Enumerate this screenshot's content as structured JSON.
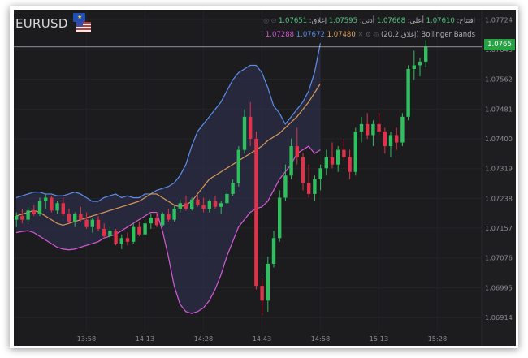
{
  "symbol": "EURUSD",
  "info": {
    "open_label": "افتتاح:",
    "open": "1.07610",
    "high_label": "أعلى:",
    "high": "1.07668",
    "low_label": "أدنى:",
    "low": "1.07595",
    "close_label": "إغلاق:",
    "close": "1.07651",
    "indicator_name": "Bollinger Bands",
    "indicator_params": "(إغلاق,20,2)",
    "upper": "1.07288",
    "middle": "1.07672",
    "lower": "1.07480"
  },
  "last_price": "1.0765",
  "colors": {
    "bull": "#2fbf5f",
    "bear": "#e0324a",
    "upper_band": "#5b8fe8",
    "lower_band": "#d65ad8",
    "middle_band": "#d99a58",
    "band_fill": "#2c2c48",
    "price_tag": "#27a345",
    "background": "#1c1c1f"
  },
  "chart_data": {
    "type": "candlestick",
    "y_ticks": [
      "1.07724",
      "1.07643",
      "1.07562",
      "1.07481",
      "1.07400",
      "1.07319",
      "1.07238",
      "1.07157",
      "1.07076",
      "1.06995",
      "1.06914"
    ],
    "x_ticks": [
      "13:58",
      "14:13",
      "14:28",
      "14:43",
      "14:58",
      "15:13",
      "15:28"
    ],
    "ylim": [
      1.0688,
      1.0775
    ],
    "candles": [
      [
        1.0718,
        1.072,
        1.0716,
        1.0719
      ],
      [
        1.0719,
        1.0721,
        1.0717,
        1.0718
      ],
      [
        1.0718,
        1.07215,
        1.07175,
        1.07205
      ],
      [
        1.07205,
        1.0722,
        1.0719,
        1.07195
      ],
      [
        1.07195,
        1.0724,
        1.0719,
        1.0723
      ],
      [
        1.0723,
        1.0725,
        1.0721,
        1.0724
      ],
      [
        1.0724,
        1.07245,
        1.072,
        1.07205
      ],
      [
        1.07205,
        1.0723,
        1.07195,
        1.07225
      ],
      [
        1.07225,
        1.0724,
        1.0719,
        1.07195
      ],
      [
        1.07195,
        1.0721,
        1.0717,
        1.07175
      ],
      [
        1.07175,
        1.072,
        1.0716,
        1.07195
      ],
      [
        1.07195,
        1.07215,
        1.07175,
        1.0718
      ],
      [
        1.0718,
        1.072,
        1.07155,
        1.0716
      ],
      [
        1.0716,
        1.07185,
        1.07145,
        1.0718
      ],
      [
        1.0718,
        1.0719,
        1.0715,
        1.07155
      ],
      [
        1.07155,
        1.0717,
        1.0713,
        1.07135
      ],
      [
        1.07135,
        1.0716,
        1.07125,
        1.0715
      ],
      [
        1.0715,
        1.07155,
        1.0711,
        1.07115
      ],
      [
        1.07115,
        1.0714,
        1.071,
        1.0713
      ],
      [
        1.0713,
        1.07145,
        1.0711,
        1.0712
      ],
      [
        1.0712,
        1.0717,
        1.07115,
        1.0716
      ],
      [
        1.0716,
        1.07175,
        1.07135,
        1.0714
      ],
      [
        1.0714,
        1.0718,
        1.07135,
        1.0717
      ],
      [
        1.0717,
        1.07195,
        1.07155,
        1.07185
      ],
      [
        1.07185,
        1.072,
        1.0716,
        1.07165
      ],
      [
        1.07165,
        1.072,
        1.0716,
        1.07195
      ],
      [
        1.07195,
        1.0721,
        1.07175,
        1.0718
      ],
      [
        1.0718,
        1.0722,
        1.07175,
        1.0721
      ],
      [
        1.0721,
        1.07235,
        1.072,
        1.07225
      ],
      [
        1.07225,
        1.07245,
        1.07205,
        1.0721
      ],
      [
        1.0721,
        1.0724,
        1.07205,
        1.07235
      ],
      [
        1.07235,
        1.0725,
        1.07215,
        1.0722
      ],
      [
        1.0722,
        1.0724,
        1.072,
        1.0721
      ],
      [
        1.0721,
        1.07235,
        1.072,
        1.0723
      ],
      [
        1.0723,
        1.07245,
        1.0721,
        1.07215
      ],
      [
        1.07215,
        1.0723,
        1.07195,
        1.07225
      ],
      [
        1.07225,
        1.07255,
        1.0722,
        1.0725
      ],
      [
        1.0725,
        1.0729,
        1.07245,
        1.0728
      ],
      [
        1.0728,
        1.0738,
        1.0727,
        1.0737
      ],
      [
        1.0737,
        1.0748,
        1.0736,
        1.0746
      ],
      [
        1.0746,
        1.075,
        1.0738,
        1.074
      ],
      [
        1.074,
        1.0742,
        1.0699,
        1.07
      ],
      [
        1.07,
        1.0702,
        1.0692,
        1.0696
      ],
      [
        1.0696,
        1.0708,
        1.0693,
        1.0706
      ],
      [
        1.0706,
        1.0715,
        1.0705,
        1.0713
      ],
      [
        1.0713,
        1.0726,
        1.0712,
        1.0724
      ],
      [
        1.0724,
        1.0733,
        1.0723,
        1.073
      ],
      [
        1.073,
        1.074,
        1.0729,
        1.0738
      ],
      [
        1.0738,
        1.0743,
        1.0733,
        1.0735
      ],
      [
        1.0735,
        1.0736,
        1.0726,
        1.0728
      ],
      [
        1.0728,
        1.0733,
        1.0724,
        1.0725
      ],
      [
        1.0725,
        1.073,
        1.0723,
        1.0729
      ],
      [
        1.0729,
        1.0733,
        1.0726,
        1.0732
      ],
      [
        1.0732,
        1.0737,
        1.073,
        1.0735
      ],
      [
        1.0735,
        1.0739,
        1.0732,
        1.0733
      ],
      [
        1.0733,
        1.0738,
        1.0731,
        1.0737
      ],
      [
        1.0737,
        1.074,
        1.0734,
        1.0735
      ],
      [
        1.0735,
        1.0737,
        1.0729,
        1.0731
      ],
      [
        1.0731,
        1.0743,
        1.073,
        1.0742
      ],
      [
        1.0742,
        1.0746,
        1.0739,
        1.0744
      ],
      [
        1.0744,
        1.0747,
        1.074,
        1.0741
      ],
      [
        1.0741,
        1.0745,
        1.0738,
        1.0744
      ],
      [
        1.0744,
        1.0747,
        1.0741,
        1.0742
      ],
      [
        1.0742,
        1.0743,
        1.0736,
        1.0738
      ],
      [
        1.0738,
        1.0742,
        1.0735,
        1.0741
      ],
      [
        1.0741,
        1.0743,
        1.0737,
        1.0739
      ],
      [
        1.0739,
        1.0747,
        1.0738,
        1.0746
      ],
      [
        1.0746,
        1.076,
        1.0745,
        1.0759
      ],
      [
        1.0759,
        1.0764,
        1.0756,
        1.076
      ],
      [
        1.076,
        1.0762,
        1.0757,
        1.0761
      ],
      [
        1.0761,
        1.07668,
        1.07595,
        1.07651
      ]
    ],
    "upper_band": [
      1.0724,
      1.07245,
      1.0725,
      1.07255,
      1.07255,
      1.0725,
      1.0725,
      1.07245,
      1.07245,
      1.0725,
      1.07255,
      1.0725,
      1.0724,
      1.0723,
      1.0723,
      1.0724,
      1.07245,
      1.0725,
      1.0724,
      1.07245,
      1.0724,
      1.0724,
      1.0725,
      1.0725,
      1.0726,
      1.07265,
      1.0727,
      1.0728,
      1.073,
      1.0733,
      1.0738,
      1.0742,
      1.0744,
      1.0746,
      1.0748,
      1.075,
      1.0753,
      1.0756,
      1.0758,
      1.0759,
      1.076,
      1.076,
      1.0758,
      1.0754,
      1.0749,
      1.0747,
      1.0744,
      1.0746,
      1.0748,
      1.075,
      1.0753,
      1.0758,
      1.0766
    ],
    "middle_band": [
      1.0719,
      1.07195,
      1.072,
      1.07205,
      1.072,
      1.0719,
      1.0718,
      1.0717,
      1.07165,
      1.0717,
      1.07175,
      1.0718,
      1.07185,
      1.0719,
      1.07195,
      1.072,
      1.07205,
      1.0721,
      1.07215,
      1.0722,
      1.07225,
      1.0723,
      1.0724,
      1.0725,
      1.0725,
      1.0724,
      1.0723,
      1.0722,
      1.07215,
      1.0722,
      1.0723,
      1.0725,
      1.0727,
      1.0729,
      1.073,
      1.0731,
      1.0732,
      1.0733,
      1.0734,
      1.0735,
      1.0736,
      1.0737,
      1.0738,
      1.07395,
      1.07405,
      1.07415,
      1.0743,
      1.07445,
      1.0746,
      1.0748,
      1.075,
      1.07525,
      1.0755
    ],
    "lower_band": [
      1.07145,
      1.07148,
      1.0715,
      1.07145,
      1.07135,
      1.07125,
      1.07115,
      1.07105,
      1.071,
      1.07098,
      1.071,
      1.07105,
      1.0711,
      1.07115,
      1.0712,
      1.0713,
      1.07135,
      1.0714,
      1.0715,
      1.0716,
      1.0717,
      1.0718,
      1.0719,
      1.072,
      1.072,
      1.0715,
      1.0708,
      1.07,
      1.0695,
      1.0693,
      1.06925,
      1.0693,
      1.0694,
      1.0696,
      1.0699,
      1.0703,
      1.0708,
      1.0712,
      1.0716,
      1.0718,
      1.072,
      1.0721,
      1.07215,
      1.0723,
      1.0726,
      1.0729,
      1.0731,
      1.0733,
      1.0736,
      1.0737,
      1.0738,
      1.0736,
      1.0737
    ]
  }
}
